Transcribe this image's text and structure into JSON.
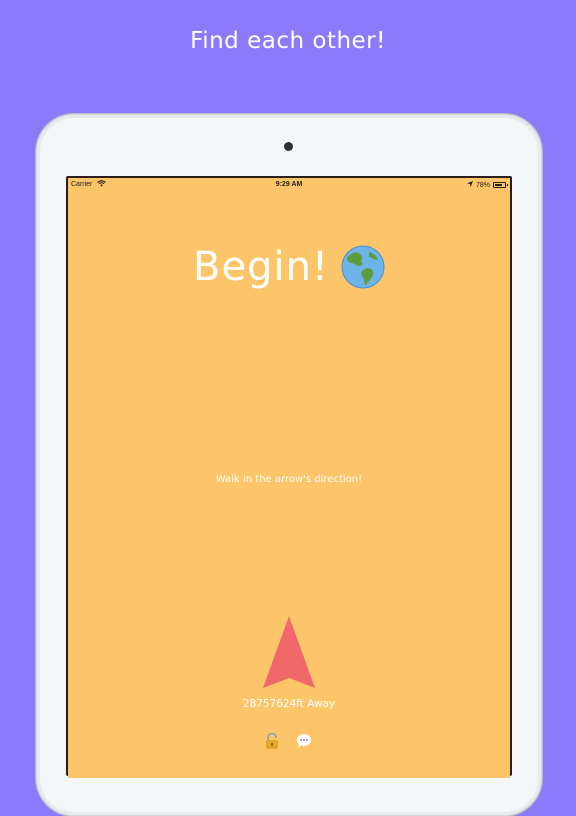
{
  "headline": "Find each other!",
  "status_bar": {
    "carrier": "Carrier",
    "time": "9:29 AM",
    "battery": "78%",
    "battery_level": 0.78
  },
  "screen": {
    "title": "Begin!",
    "instruction": "Walk in the arrow's direction!",
    "distance": "28757624ft Away"
  },
  "icons": {
    "globe": "globe-americas-icon",
    "arrow": "direction-arrow-icon",
    "lock": "lock-icon",
    "chat": "chat-bubble-icon"
  },
  "colors": {
    "background": "#8b7bfb",
    "screen": "#fdc56a",
    "arrow": "#f0686a"
  }
}
